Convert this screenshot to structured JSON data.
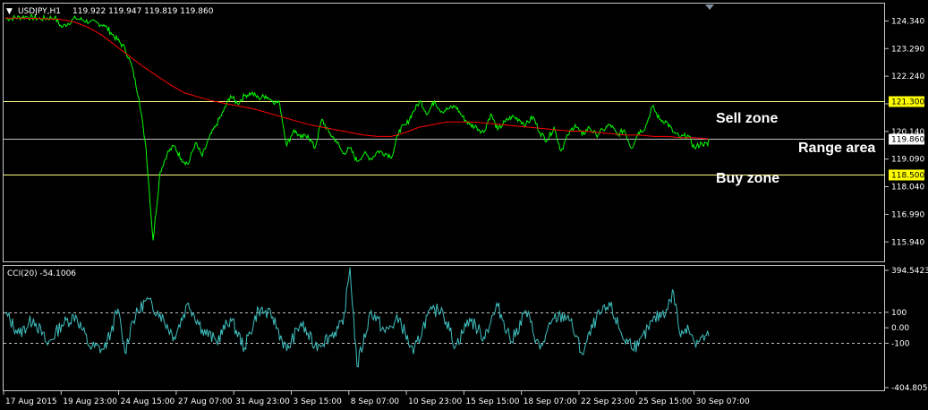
{
  "colors": {
    "background": "#000000",
    "frame": "#c8c8c8",
    "price": "#00ff00",
    "ma": "#ff0000",
    "sell_line": "#ffff80",
    "range_line": "#c0c0c0",
    "buy_line": "#ffff80",
    "cci": "#40c0c0",
    "label_bg": "#ffff00",
    "text": "#ffffff"
  },
  "main_header": {
    "arrow": "▼",
    "symbol": "USDJPY,H1",
    "ohlc": "119.922 119.947 119.819 119.860"
  },
  "cci_header": "CCI(20) -54.1006",
  "annotations": {
    "sell": "Sell zone",
    "range": "Range area",
    "buy": "Buy zone"
  },
  "chart_data": [
    {
      "type": "line",
      "name_shown": "USDJPY,H1",
      "ylim": [
        115.2,
        125.0
      ],
      "y_ticks": [
        124.34,
        123.29,
        122.24,
        121.19,
        120.14,
        119.09,
        118.04,
        116.99,
        115.94
      ],
      "y_tick_labels": [
        "124.340",
        "123.290",
        "122.240",
        "121.190",
        "120.140",
        "119.090",
        "118.040",
        "116.990",
        "115.940"
      ],
      "x_tick_labels": [
        "17 Aug 2015",
        "19 Aug 23:00",
        "24 Aug 15:00",
        "27 Aug 07:00",
        "31 Aug 23:00",
        "3 Sep 15:00",
        "8 Sep 07:00",
        "10 Sep 23:00",
        "15 Sep 15:00",
        "18 Sep 07:00",
        "22 Sep 23:00",
        "25 Sep 15:00",
        "30 Sep 07:00"
      ],
      "horizontal_levels": [
        {
          "value": 121.3,
          "label": "121.300",
          "role": "sell"
        },
        {
          "value": 119.86,
          "label": "119.860",
          "role": "range"
        },
        {
          "value": 118.5,
          "label": "118.500",
          "role": "buy"
        }
      ],
      "x": [
        0,
        3,
        5,
        7,
        8,
        10,
        12,
        14,
        15,
        17,
        18,
        19,
        20,
        21,
        22,
        23,
        24,
        25,
        26,
        27,
        28,
        29,
        30,
        31,
        32,
        33,
        34,
        35,
        36,
        37,
        38,
        39,
        40,
        41,
        42,
        43,
        44,
        45,
        46,
        47,
        48,
        49,
        50,
        51,
        52,
        53,
        54,
        55,
        56,
        57,
        58,
        59,
        60,
        61,
        62,
        63,
        64,
        65,
        66,
        67,
        68,
        69,
        70,
        71,
        72,
        73,
        74,
        75,
        76,
        77,
        78,
        79,
        80,
        81,
        82,
        83,
        84,
        85,
        86,
        87,
        88,
        89,
        90,
        91,
        92,
        93,
        94,
        95,
        96,
        97,
        98,
        99,
        100
      ],
      "series": [
        {
          "role": "price",
          "values": [
            124.43,
            124.5,
            124.42,
            124.48,
            124.1,
            124.45,
            124.3,
            124.2,
            123.9,
            123.3,
            122.6,
            121.4,
            119.5,
            116.0,
            118.6,
            119.3,
            119.6,
            119.1,
            118.9,
            119.7,
            119.2,
            119.9,
            120.4,
            120.9,
            121.5,
            121.2,
            121.5,
            121.6,
            121.4,
            121.5,
            121.3,
            121.2,
            119.6,
            120.2,
            119.9,
            120.0,
            119.5,
            120.6,
            120.1,
            119.8,
            119.3,
            119.5,
            119.0,
            119.3,
            119.1,
            119.4,
            119.3,
            119.2,
            120.2,
            120.4,
            120.9,
            121.3,
            120.8,
            121.3,
            120.9,
            121.0,
            121.1,
            120.7,
            120.4,
            120.3,
            120.1,
            120.8,
            120.2,
            120.5,
            120.7,
            120.6,
            120.4,
            120.7,
            120.1,
            119.8,
            120.3,
            119.4,
            120.0,
            120.4,
            120.0,
            120.3,
            120.0,
            120.2,
            120.4,
            120.0,
            120.2,
            119.5,
            120.1,
            120.3,
            121.1,
            120.6,
            120.5,
            120.1,
            119.9,
            120.0,
            119.5,
            119.7,
            119.6,
            119.9,
            119.8,
            120.3,
            119.86
          ]
        },
        {
          "role": "moving-average",
          "values": [
            124.45,
            124.45,
            124.44,
            124.42,
            124.4,
            124.3,
            124.1,
            123.8,
            123.4,
            123.0,
            122.6,
            122.25,
            121.9,
            121.6,
            121.45,
            121.3,
            121.2,
            121.1,
            121.0,
            120.85,
            120.7,
            120.55,
            120.4,
            120.3,
            120.2,
            120.1,
            120.0,
            119.95,
            119.95,
            120.1,
            120.3,
            120.4,
            120.5,
            120.5,
            120.5,
            120.45,
            120.4,
            120.35,
            120.3,
            120.25,
            120.2,
            120.15,
            120.15,
            120.1,
            120.05,
            120.0,
            120.0,
            119.95,
            119.95,
            119.9,
            119.9,
            119.86
          ]
        }
      ]
    },
    {
      "type": "line",
      "name_shown": "CCI(20)",
      "ylim": [
        -404.805,
        394.5423
      ],
      "y_ticks": [
        394.5423,
        100,
        0,
        -100,
        -404.805
      ],
      "y_tick_labels": [
        "394.5423",
        "100",
        "0.00",
        "-100",
        "-404.805"
      ],
      "dashed_levels": [
        100,
        -100
      ],
      "x": [
        0,
        2,
        4,
        6,
        8,
        10,
        12,
        14,
        15,
        16,
        17,
        18,
        20,
        22,
        24,
        26,
        28,
        30,
        32,
        34,
        36,
        38,
        40,
        42,
        44,
        46,
        48,
        49,
        50,
        52,
        54,
        56,
        58,
        60,
        62,
        64,
        66,
        68,
        70,
        72,
        74,
        76,
        78,
        80,
        82,
        84,
        86,
        88,
        90,
        92,
        94,
        95,
        96,
        97,
        98,
        100
      ],
      "values": [
        90,
        -40,
        60,
        -110,
        20,
        80,
        -120,
        -140,
        -30,
        120,
        -160,
        40,
        180,
        90,
        -60,
        160,
        -10,
        -90,
        60,
        -130,
        120,
        70,
        -150,
        30,
        -120,
        -60,
        20,
        390,
        -250,
        110,
        -30,
        60,
        -170,
        80,
        130,
        -120,
        60,
        -60,
        140,
        -90,
        110,
        -140,
        60,
        80,
        -170,
        60,
        140,
        -80,
        -120,
        40,
        120,
        230,
        -60,
        20,
        -90,
        -54.1
      ]
    }
  ]
}
